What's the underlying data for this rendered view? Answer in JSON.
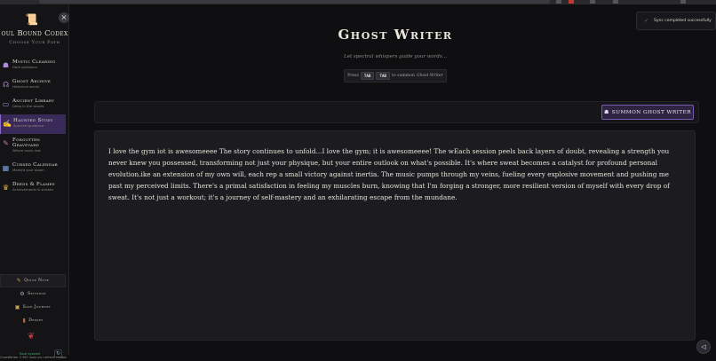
{
  "sidebar": {
    "collapse_icon": "×",
    "brand_icon": "scroll-icon",
    "brand_title": "oul Bound Codex",
    "brand_subtitle": "Choose Your Path",
    "items": [
      {
        "label": "Mystic Clearing",
        "desc": "Dark guidance",
        "icon": "☗"
      },
      {
        "label": "Ghost Archive",
        "desc": "Historical winds",
        "icon": "☊"
      },
      {
        "label": "Ancient Library",
        "desc": "Deep in the woods",
        "icon": "▭"
      },
      {
        "label": "Haunted Study",
        "desc": "Spectral guidance",
        "icon": "✍"
      },
      {
        "label": "Forgotten Graveyard",
        "desc": "Where souls rest",
        "icon": "✎"
      },
      {
        "label": "Cursed Calendar",
        "desc": "Marked your doom",
        "icon": "▦"
      },
      {
        "label": "Deeds & Flames",
        "desc": "Achievements & streaks",
        "icon": "♛"
      }
    ],
    "bottom_buttons": [
      {
        "label": "Quick Note",
        "icon": "✎"
      },
      {
        "label": "Settings",
        "icon": "⚙"
      },
      {
        "label": "Save Journey",
        "icon": "▣"
      },
      {
        "label": "Depart",
        "icon": "▮"
      }
    ],
    "mascot_icon": "❦",
    "status_text": "Soul synced",
    "refresh_icon": "↻"
  },
  "main": {
    "title": "Ghost Writer",
    "subtitle": "Let spectral whispers guide your words...",
    "hint": {
      "prefix": "Press",
      "key1": "TAB",
      "key2": "TAB",
      "middle": "to summon",
      "name": "Ghost Writer"
    },
    "summon_button": {
      "label": "SUMMON GHOST WRITER",
      "icon": "☗"
    },
    "editor_text": "I love the gym iot is awesomeeee The story continues to unfold...I love the gym; it is awesomeeee! The wEach session peels back layers of doubt, revealing a strength you never knew you possessed, transforming not just your physique, but your entire outlook on what's possible. It's where sweat becomes a catalyst for profound personal evolution.ike an extension of my own will, each rep a small victory against inertia. The music pumps through my veins, fueling every explosive movement and pushing me past my perceived limits. There's a primal satisfaction in feeling my muscles burn, knowing that I'm forging a stronger, more resilient version of myself with every drop of sweat. It's not just a workout; it's a journey of self-mastery and an exhilarating escape from the mundane."
  },
  "toast": {
    "message": "Sync completed successfully",
    "icon": "✓"
  },
  "audio_icon": "speaker-icon",
  "audio_glyph": "◁",
  "footer": "ChostWriter 2 587 nodc.scri refresh modes",
  "colors": {
    "accent": "#8f6ad0",
    "active_bg": "#3a2a5a",
    "success": "#4fb377"
  }
}
